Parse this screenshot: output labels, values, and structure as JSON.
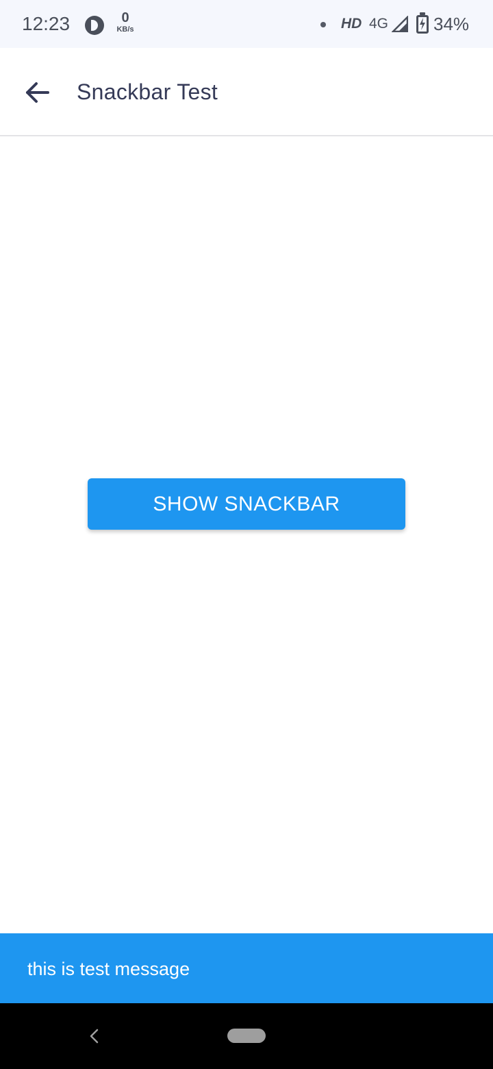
{
  "status_bar": {
    "time": "12:23",
    "speed_value": "0",
    "speed_unit": "KB/s",
    "hd_label": "HD",
    "network": "4G",
    "battery_text": "34%"
  },
  "app_bar": {
    "title": "Snackbar Test",
    "back_icon": "arrow-left-icon"
  },
  "main": {
    "show_button_label": "SHOW SNACKBAR"
  },
  "snackbar": {
    "message": "this is test message"
  },
  "colors": {
    "accent": "#1e96f0",
    "title_text": "#353a57",
    "status_bar_bg": "#f5f7fd"
  }
}
